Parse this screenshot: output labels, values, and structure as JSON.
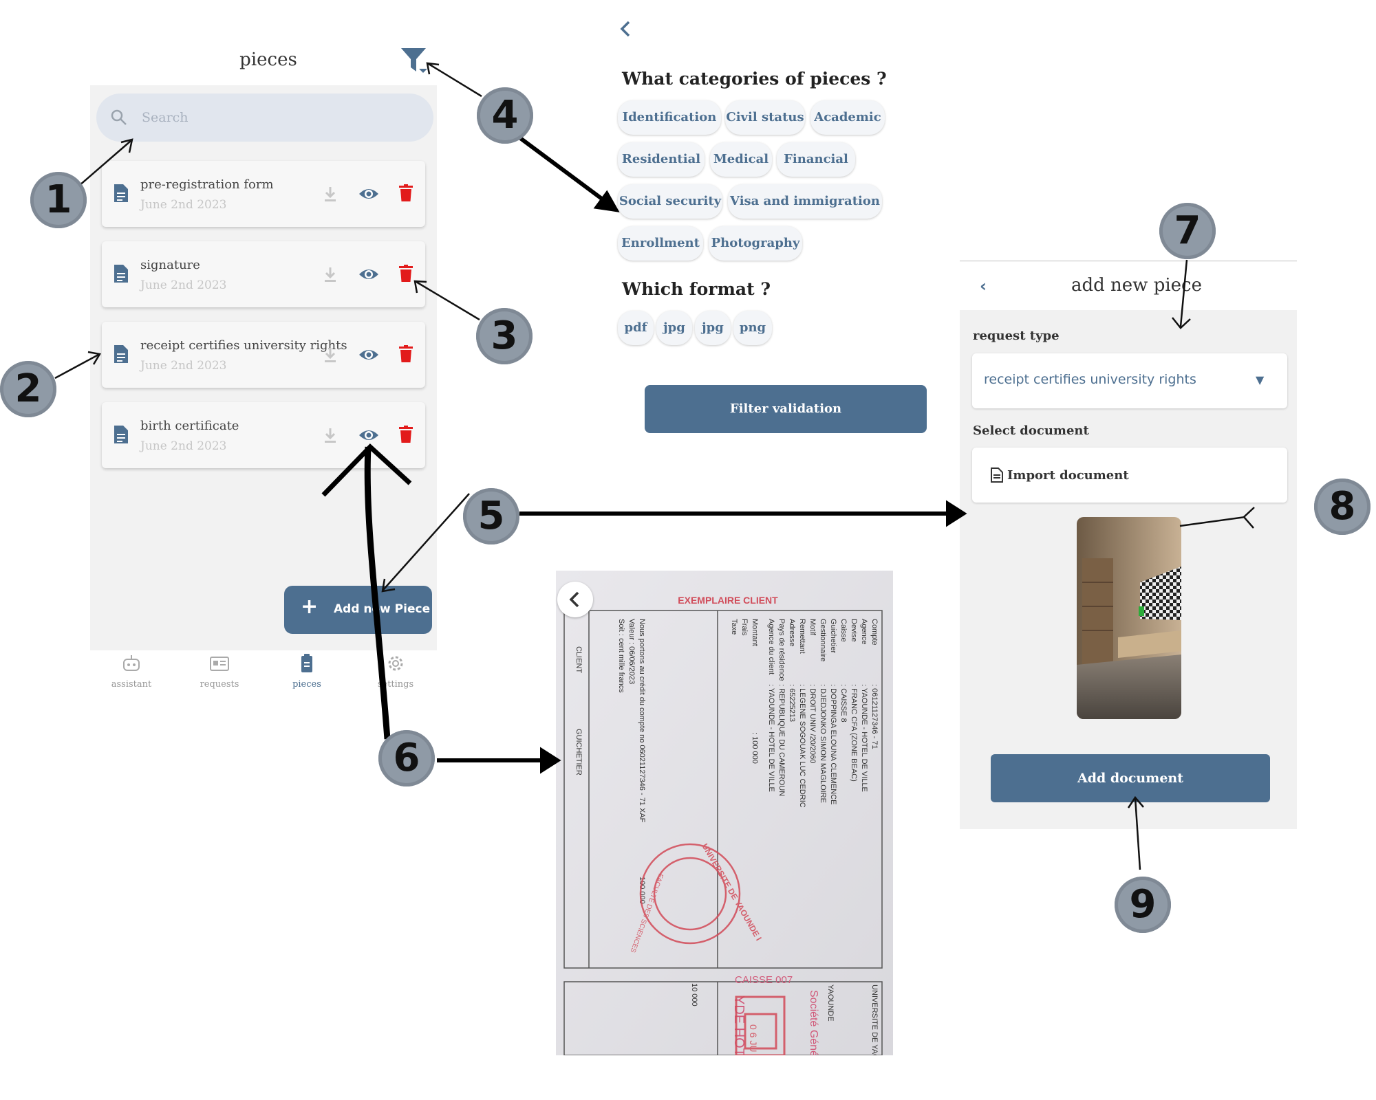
{
  "pieces_screen": {
    "title": "pieces",
    "search_placeholder": "Search",
    "items": [
      {
        "name": "pre-registration form",
        "date": "June 2nd 2023"
      },
      {
        "name": "signature",
        "date": "June 2nd 2023"
      },
      {
        "name": "receipt certifies university rights",
        "date": "June 2nd 2023"
      },
      {
        "name": "birth certificate",
        "date": "June 2nd 2023"
      }
    ],
    "add_button": "Add new Piece",
    "nav": [
      {
        "label": "assistant",
        "icon": "robot-icon"
      },
      {
        "label": "requests",
        "icon": "id-card-icon"
      },
      {
        "label": "pieces",
        "icon": "clipboard-icon",
        "active": true
      },
      {
        "label": "settings",
        "icon": "gear-icon"
      }
    ]
  },
  "filter_screen": {
    "categories_title": "What categories of pieces ?",
    "categories": [
      "Identification",
      "Civil status",
      "Academic",
      "Residential",
      "Medical",
      "Financial",
      "Social security",
      "Visa and immigration",
      "Enrollment",
      "Photography"
    ],
    "format_title": "Which format ?",
    "formats": [
      "pdf",
      "jpg",
      "jpg",
      "png"
    ],
    "validate_button": "Filter validation"
  },
  "add_piece_screen": {
    "title": "add new piece",
    "request_type_label": "request type",
    "request_type_value": "receipt certifies university rights",
    "select_document_label": "Select document",
    "import_label": "Import document",
    "add_button": "Add document"
  },
  "receipt_photo": {
    "header": "EXEMPLAIRE CLIENT",
    "field_labels": [
      "Compte",
      "Agence",
      "Devise",
      "Caisse",
      "Guichetier",
      "Gestionnaire",
      "Motif",
      "Remettant",
      "Adresse",
      "Pays de résidence",
      "Agence du client",
      "Montant",
      "Frais",
      "Taxe"
    ],
    "field_values": [
      ": 06121127346 - 71",
      ": YAOUNDE - HOTEL DE VILLE",
      ": FRANC CFA (ZONE BEAC)",
      ": CAISSE 8",
      ": DOPPINGA ELOUNA CLEMENCE",
      ": DJEDJONKO SIMON MAGLOIRE",
      ": DROIT UNIV /20/2060",
      ": LEGENE SOGOUAK LUC CEDRIC",
      ": 65225213",
      ": REPUBLIQUE DU CAMEROUN",
      ": YAOUNDE - HOTEL DE VILLE",
      ": 100 000"
    ],
    "notes": [
      "Nous portons au crédit du compte no 06021127346 - 71   XAF",
      "Valeur : 06/06/2023",
      "Soit : cent mille francs",
      "100 000"
    ],
    "side_labels": [
      "CLIENT",
      "GUICHETIER"
    ],
    "amount_lower": "10 000",
    "lower_texts": [
      "UNIVERSITE DE YAOUNDE",
      "YAOUNDE",
      "Société Géné",
      "CAISSE 007",
      "YDE HOTE"
    ],
    "stamp_text": "UNIVERSITE DE YAOUNDE I",
    "stamp_inner": "FACULTE DES SCIENCES",
    "stamp_date": "0 6 JU"
  },
  "markers": [
    "1",
    "2",
    "3",
    "4",
    "5",
    "6",
    "7",
    "8",
    "9"
  ]
}
